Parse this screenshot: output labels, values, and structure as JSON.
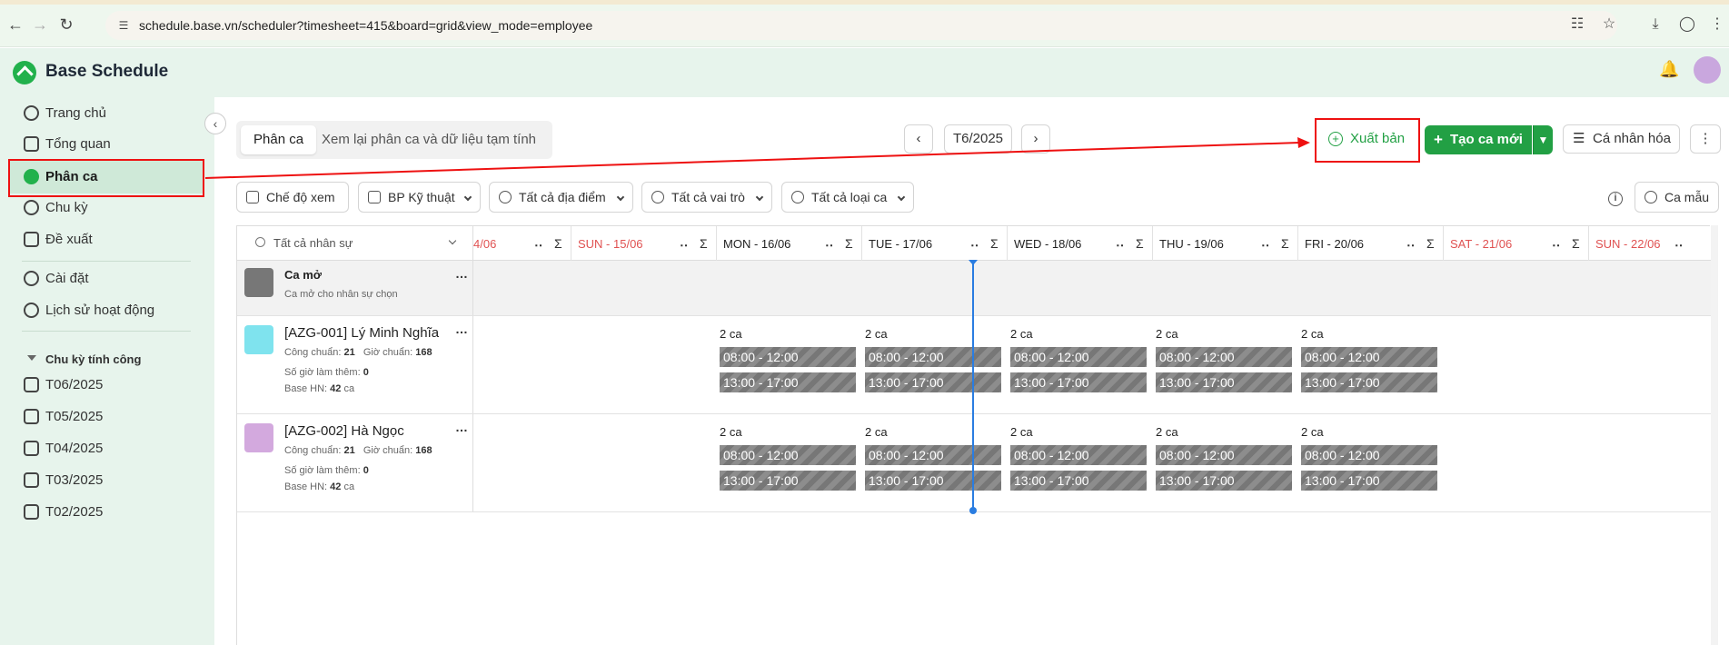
{
  "browser": {
    "url": "schedule.base.vn/scheduler?timesheet=415&board=grid&view_mode=employee"
  },
  "app": {
    "title": "Base Schedule"
  },
  "sidebar": {
    "items": [
      {
        "label": "Trang chủ",
        "icon": "clock-icon"
      },
      {
        "label": "Tổng quan",
        "icon": "grid-icon"
      },
      {
        "label": "Phân ca",
        "icon": "schedule-icon"
      },
      {
        "label": "Chu kỳ",
        "icon": "cycle-icon"
      },
      {
        "label": "Đề xuất",
        "icon": "document-icon"
      }
    ],
    "settings": [
      {
        "label": "Cài đặt",
        "icon": "gear-icon"
      },
      {
        "label": "Lịch sử hoạt động",
        "icon": "history-icon"
      }
    ],
    "section_title": "Chu kỳ tính công",
    "periods": [
      "T06/2025",
      "T05/2025",
      "T04/2025",
      "T03/2025",
      "T02/2025"
    ]
  },
  "toolbar": {
    "tab_active": "Phân ca",
    "tab_other": "Xem lại phân ca và dữ liệu tạm tính",
    "period": "T6/2025",
    "export_label": "Xuất bản",
    "create_label": "Tạo ca mới",
    "personalize_label": "Cá nhân hóa"
  },
  "filters": {
    "view_mode": "Chế độ xem",
    "department": "BP Kỹ thuật",
    "locations": "Tất cả địa điểm",
    "roles": "Tất cả vai trò",
    "shift_types": "Tất cả loại ca",
    "template": "Ca mẫu"
  },
  "grid": {
    "search_placeholder": "Tất cả nhân sự",
    "days": [
      {
        "label": "4/06",
        "weekend": true
      },
      {
        "label": "SUN - 15/06",
        "weekend": true
      },
      {
        "label": "MON - 16/06",
        "weekend": false
      },
      {
        "label": "TUE - 17/06",
        "weekend": false
      },
      {
        "label": "WED - 18/06",
        "weekend": false
      },
      {
        "label": "THU - 19/06",
        "weekend": false
      },
      {
        "label": "FRI - 20/06",
        "weekend": false
      },
      {
        "label": "SAT - 21/06",
        "weekend": true
      },
      {
        "label": "SUN - 22/06",
        "weekend": true
      }
    ],
    "open_shift": {
      "title": "Ca mở",
      "subtitle": "Ca mở cho nhân sự chọn"
    },
    "employees": [
      {
        "name": "[AZG-001] Lý Minh Nghĩa",
        "standard_days_label": "Công chuẩn:",
        "standard_days": "21",
        "standard_hours_label": "Giờ chuẩn:",
        "standard_hours": "168",
        "overtime_label": "Số giờ làm thêm:",
        "overtime": "0",
        "base_label": "Base HN:",
        "base_value": "42",
        "base_unit": "ca",
        "avatar_color": "#7fe3ee",
        "shift_count": "2 ca",
        "shifts": [
          "08:00 - 12:00",
          "13:00 - 17:00"
        ]
      },
      {
        "name": "[AZG-002] Hà Ngọc",
        "standard_days_label": "Công chuẩn:",
        "standard_days": "21",
        "standard_hours_label": "Giờ chuẩn:",
        "standard_hours": "168",
        "overtime_label": "Số giờ làm thêm:",
        "overtime": "0",
        "base_label": "Base HN:",
        "base_value": "42",
        "base_unit": "ca",
        "avatar_color": "#d3a9de",
        "shift_count": "2 ca",
        "shifts": [
          "08:00 - 12:00",
          "13:00 - 17:00"
        ]
      }
    ]
  }
}
